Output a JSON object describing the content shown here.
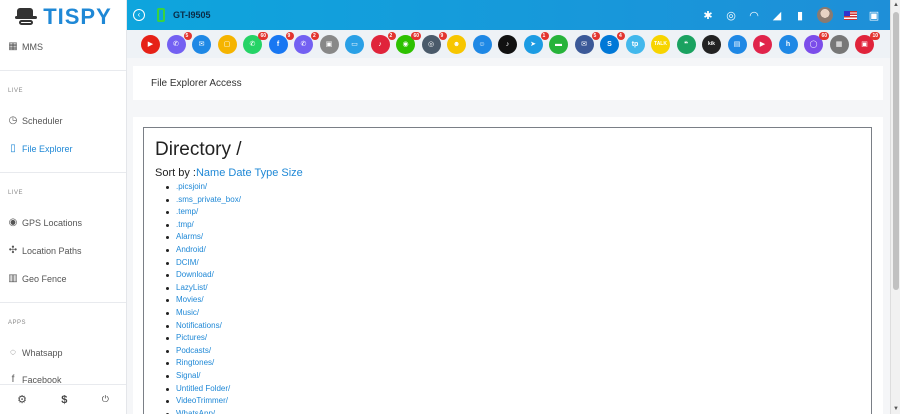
{
  "brand": {
    "logo_text": "TISPY"
  },
  "sidebar": {
    "items_top": [
      {
        "icon": "sms-icon",
        "label": "MMS"
      }
    ],
    "section1": "LIVE",
    "items_live1": [
      {
        "icon": "clock-icon",
        "label": "Scheduler"
      },
      {
        "icon": "file-icon",
        "label": "File Explorer",
        "active": true
      }
    ],
    "section2": "LIVE",
    "items_live2": [
      {
        "icon": "map-pin-icon",
        "label": "GPS Locations"
      },
      {
        "icon": "route-icon",
        "label": "Location Paths"
      },
      {
        "icon": "map-icon",
        "label": "Geo Fence"
      }
    ],
    "section3": "APPS",
    "items_apps": [
      {
        "icon": "whatsapp-icon",
        "label": "Whatsapp"
      },
      {
        "icon": "facebook-icon",
        "label": "Facebook"
      }
    ],
    "footer": [
      {
        "icon": "gear-icon",
        "glyph": "⚙"
      },
      {
        "icon": "dollar-icon",
        "glyph": "$"
      },
      {
        "icon": "power-icon",
        "glyph": "⏻"
      }
    ]
  },
  "topbar": {
    "device_name": "GT-I9505",
    "icons": [
      "bluetooth-icon",
      "gps-icon",
      "wifi-icon",
      "signal-icon",
      "battery-icon",
      "avatar",
      "flag-icon",
      "gift-icon"
    ],
    "accent": "#1e8fd8"
  },
  "apps": [
    {
      "name": "youtube",
      "color": "#e62117",
      "glyph": "▶",
      "badge": ""
    },
    {
      "name": "viber",
      "color": "#7360f2",
      "glyph": "✆",
      "badge": "5"
    },
    {
      "name": "email",
      "color": "#1e88e5",
      "glyph": "✉",
      "badge": ""
    },
    {
      "name": "files",
      "color": "#f5b400",
      "glyph": "▢",
      "badge": ""
    },
    {
      "name": "whatsapp",
      "color": "#25d366",
      "glyph": "✆",
      "badge": "60"
    },
    {
      "name": "facebook",
      "color": "#1877f2",
      "glyph": "f",
      "badge": "9"
    },
    {
      "name": "viber2",
      "color": "#7360f2",
      "glyph": "✆",
      "badge": "2"
    },
    {
      "name": "clipboard",
      "color": "#888888",
      "glyph": "▣",
      "badge": ""
    },
    {
      "name": "screen",
      "color": "#29a0e6",
      "glyph": "▭",
      "badge": ""
    },
    {
      "name": "tiktok-red",
      "color": "#e0243b",
      "glyph": "♪",
      "badge": "2"
    },
    {
      "name": "wechat",
      "color": "#2dc100",
      "glyph": "◉",
      "badge": "60"
    },
    {
      "name": "instagram",
      "color": "#4a5a6a",
      "glyph": "◎",
      "badge": "9"
    },
    {
      "name": "snapchat",
      "color": "#f7c600",
      "glyph": "☻",
      "badge": ""
    },
    {
      "name": "discord",
      "color": "#1e88e5",
      "glyph": "☺",
      "badge": ""
    },
    {
      "name": "tiktok",
      "color": "#111111",
      "glyph": "♪",
      "badge": ""
    },
    {
      "name": "telegram",
      "color": "#1c9ce3",
      "glyph": "➤",
      "badge": "1"
    },
    {
      "name": "line",
      "color": "#26b33a",
      "glyph": "▬",
      "badge": ""
    },
    {
      "name": "messenger",
      "color": "#3b5998",
      "glyph": "✉",
      "badge": "5"
    },
    {
      "name": "skype",
      "color": "#0078d7",
      "glyph": "S",
      "badge": "4"
    },
    {
      "name": "tango",
      "color": "#42b8ec",
      "glyph": "tp",
      "badge": ""
    },
    {
      "name": "kakao",
      "color": "#f7d400",
      "glyph": "TALK",
      "badge": ""
    },
    {
      "name": "hangouts",
      "color": "#1aa260",
      "glyph": "❝",
      "badge": ""
    },
    {
      "name": "kik",
      "color": "#222222",
      "glyph": "kik",
      "badge": ""
    },
    {
      "name": "imo",
      "color": "#1e88e5",
      "glyph": "▤",
      "badge": ""
    },
    {
      "name": "video",
      "color": "#e0244b",
      "glyph": "▶",
      "badge": ""
    },
    {
      "name": "hike",
      "color": "#1e88e5",
      "glyph": "h",
      "badge": ""
    },
    {
      "name": "chat-bubble",
      "color": "#7b4dea",
      "glyph": "◯",
      "badge": "60"
    },
    {
      "name": "app-gray",
      "color": "#777777",
      "glyph": "▦",
      "badge": ""
    },
    {
      "name": "app-red",
      "color": "#e0243b",
      "glyph": "▣",
      "badge": "10"
    }
  ],
  "page": {
    "header_title": "File Explorer Access"
  },
  "explorer": {
    "title": "Directory /",
    "sort_label": "Sort by :",
    "sort_options": [
      "Name",
      "Date",
      "Type",
      "Size"
    ],
    "entries": [
      ".picsjoin/",
      ".sms_private_box/",
      ".temp/",
      ".tmp/",
      "Alarms/",
      "Android/",
      "DCIM/",
      "Download/",
      "LazyList/",
      "Movies/",
      "Music/",
      "Notifications/",
      "Pictures/",
      "Podcasts/",
      "Ringtones/",
      "Signal/",
      "Untitled Folder/",
      "VideoTrimmer/",
      "WhatsApp/"
    ]
  }
}
